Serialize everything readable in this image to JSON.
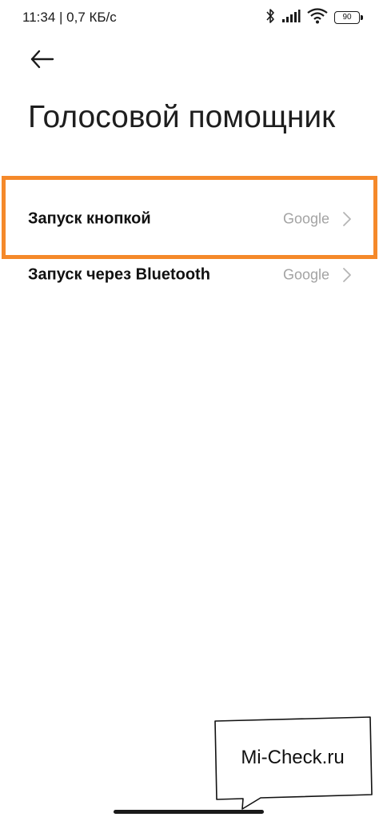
{
  "status_bar": {
    "left_text": "11:34 | 0,7 КБ/с",
    "battery_level": "90",
    "icons": [
      "bluetooth-icon",
      "signal-icon",
      "wifi-icon",
      "battery-icon"
    ]
  },
  "header": {
    "back_icon": "arrow-left-icon",
    "title": "Голосовой помощник"
  },
  "settings": {
    "items": [
      {
        "label": "Запуск кнопкой",
        "value": "Google",
        "highlighted": true
      },
      {
        "label": "Запуск через Bluetooth",
        "value": "Google",
        "highlighted": false
      }
    ]
  },
  "watermark": {
    "text": "Mi-Check.ru"
  },
  "colors": {
    "highlight": "#f5892a",
    "value_text": "#a3a3a3",
    "background": "#ffffff"
  }
}
